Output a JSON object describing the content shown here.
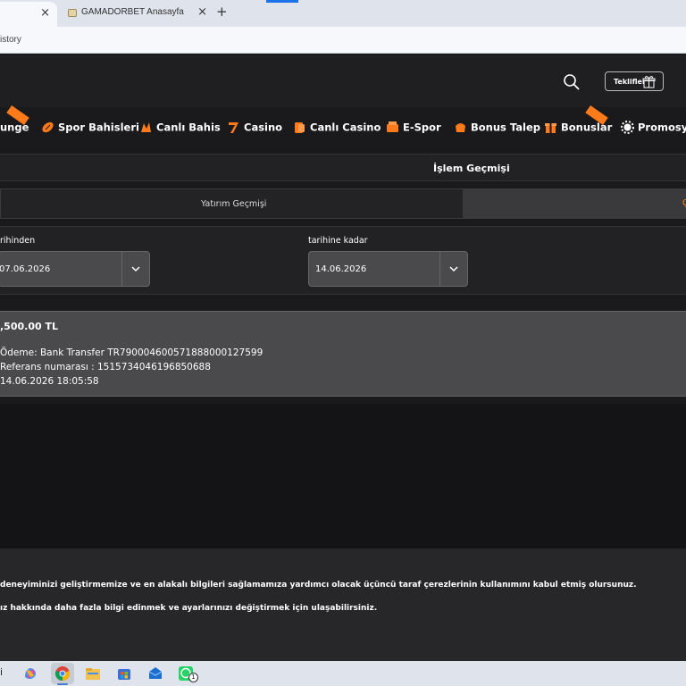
{
  "browser": {
    "active_tab_close": "×",
    "inactive_tab_title": "GAMADORBET Anasayfa",
    "inactive_tab_close": "×",
    "new_tab": "+",
    "address_partial": "istory"
  },
  "header": {
    "offers_label": "Teklifler"
  },
  "nav": {
    "items": [
      {
        "label": "unge",
        "icon": "lounge-icon"
      },
      {
        "label": "Spor Bahisleri",
        "icon": "football-icon"
      },
      {
        "label": "Canlı Bahis",
        "icon": "live-bet-icon"
      },
      {
        "label": "Casino",
        "icon": "seven-icon"
      },
      {
        "label": "Canlı Casino",
        "icon": "live-casino-icon"
      },
      {
        "label": "E-Spor",
        "icon": "esports-icon"
      },
      {
        "label": "Bonus Talep",
        "icon": "bonus-request-icon"
      },
      {
        "label": "Bonuslar",
        "icon": "gift-icon"
      },
      {
        "label": "Promosyo",
        "icon": "promo-icon"
      }
    ]
  },
  "history": {
    "title": "İşlem Geçmişi",
    "tabs": [
      {
        "label": "Yatırım Geçmişi",
        "active": false
      },
      {
        "label": "Ç",
        "active": true
      }
    ]
  },
  "filters": {
    "from_label": "rihinden",
    "from_value": "07.06.2026",
    "to_label": "tarihine kadar",
    "to_value": "14.06.2026"
  },
  "transaction": {
    "amount": ",500.00 TL",
    "payment": "Ödeme: Bank Transfer TR790004600571888000127599",
    "reference": "Referans numarası : 1515734046196850688",
    "datetime": "14.06.2026 18:05:58"
  },
  "cookie": {
    "line1": "deneyiminizi geliştirmemize ve en alakalı bilgileri sağlamamıza yardımcı olacak üçüncü taraf çerezlerinin kullanımını kabul etmiş olursunuz.",
    "line2": "ız hakkında daha fazla bilgi edinmek ve ayarlarınızı değiştirmek için ulaşabilirsiniz."
  },
  "taskbar": {
    "partial_char": "i",
    "whatsapp_badge": "1"
  },
  "colors": {
    "accent": "#ff7a1a",
    "bg": "#1a1a1c"
  }
}
